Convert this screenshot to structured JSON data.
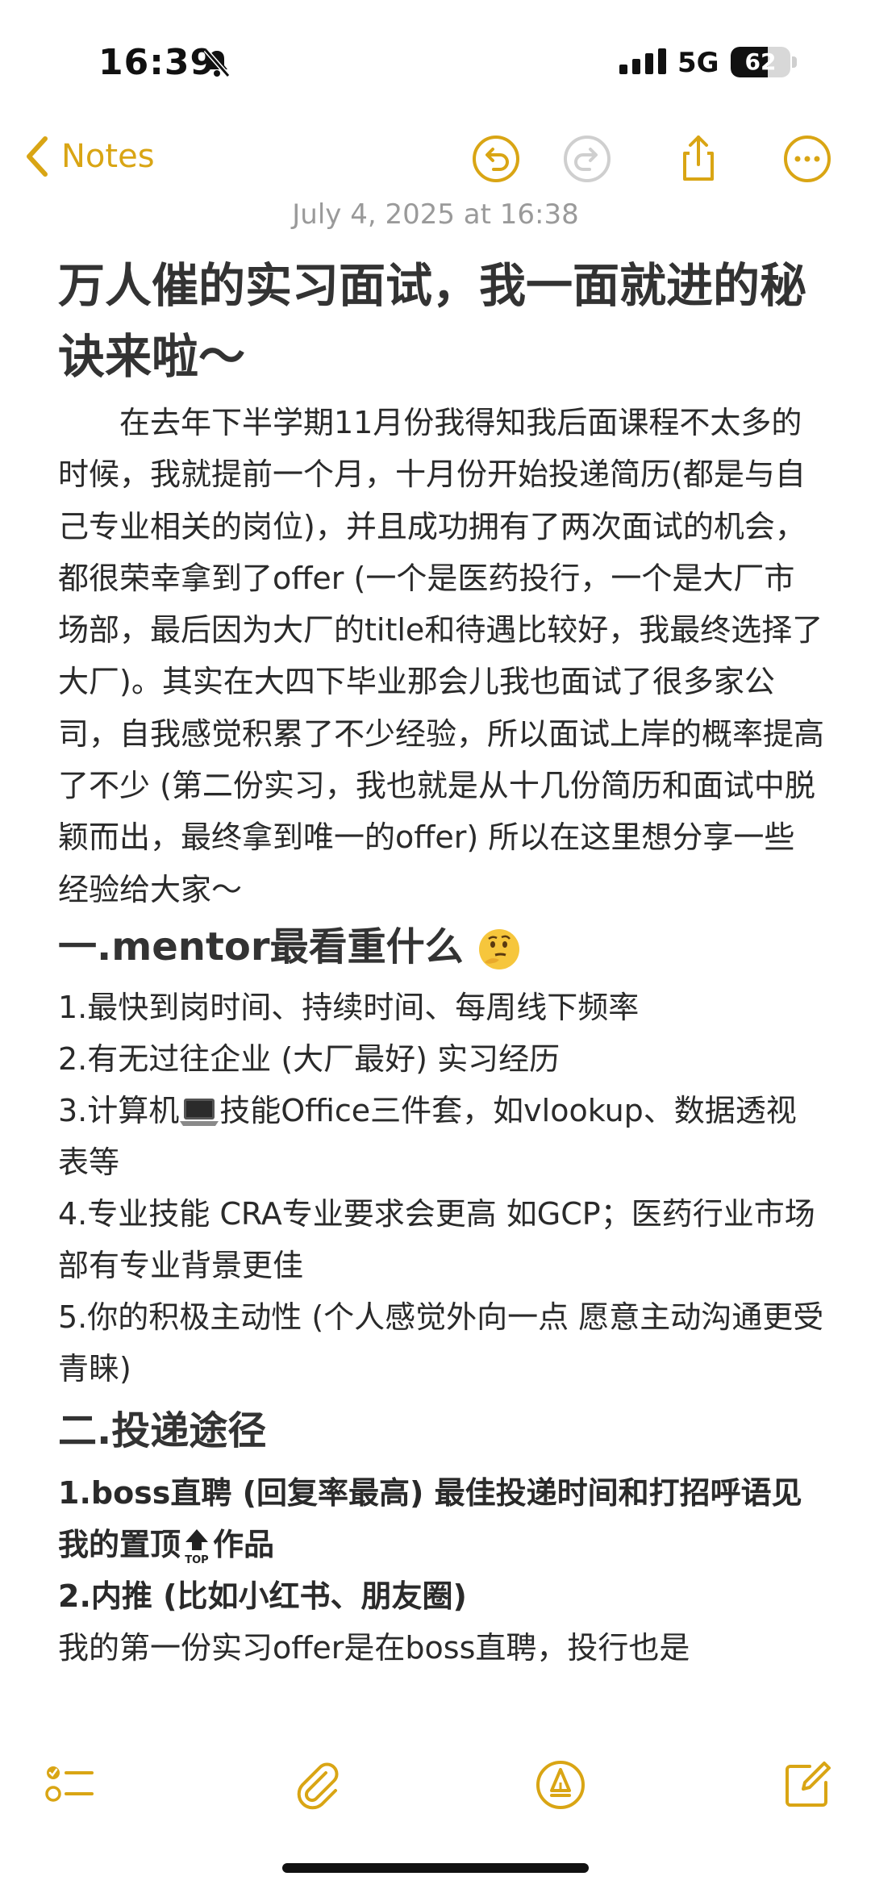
{
  "status": {
    "time": "16:39",
    "network": "5G",
    "battery": "62",
    "battery_level": 0.62
  },
  "toolbar": {
    "back_label": "Notes"
  },
  "note": {
    "date": "July 4, 2025 at 16:38",
    "title": "万人催的实习面试，我一面就进的秘诀来啦～",
    "intro": "在去年下半学期11月份我得知我后面课程不太多的时候，我就提前一个月，十月份开始投递简历(都是与自己专业相关的岗位)，并且成功拥有了两次面试的机会，都很荣幸拿到了offer (一个是医药投行，一个是大厂市场部，最后因为大厂的title和待遇比较好，我最终选择了大厂)。其实在大四下毕业那会儿我也面试了很多家公司，自我感觉积累了不少经验，所以面试上岸的概率提高了不少 (第二份实习，我也就是从十几份简历和面试中脱颖而出，最终拿到唯一的offer) 所以在这里想分享一些经验给大家～",
    "section1": {
      "heading": "一.mentor最看重什么"
    },
    "item1": "1.最快到岗时间、持续时间、每周线下频率",
    "item2": "2.有无过往企业 (大厂最好) 实习经历",
    "item3a": "3.计算机",
    "item3b": "技能Office三件套，如vlookup、数据透视表等",
    "item4": "4.专业技能 CRA专业要求会更高 如GCP；医药行业市场部有专业背景更佳",
    "item5": "5.你的积极主动性 (个人感觉外向一点 愿意主动沟通更受青睐)",
    "section2": {
      "heading": "二.投递途径"
    },
    "route1a": "1.boss直聘 (回复率最高) 最佳投递时间和打招呼语见我的置顶",
    "route1b": "作品",
    "route2": "2.内推 (比如小红书、朋友圈)",
    "body2": "我的第一份实习offer是在boss直聘，投行也是"
  },
  "colors": {
    "accent": "#d9a514",
    "text": "#2a2a2a",
    "date": "#9a9a9a"
  }
}
